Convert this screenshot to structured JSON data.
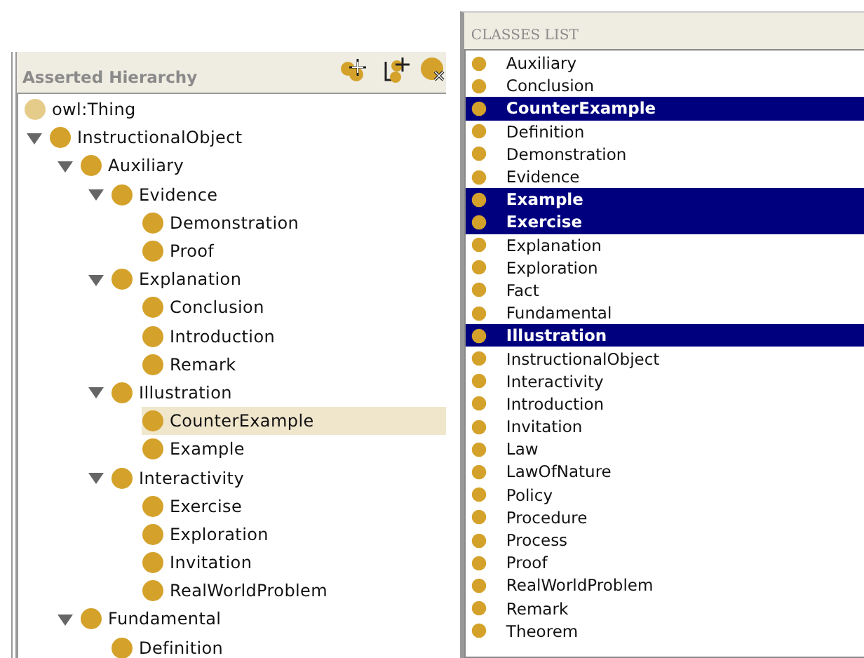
{
  "hierarchy": {
    "title": "Asserted Hierarchy",
    "tree": [
      {
        "label": "owl:Thing",
        "kind": "thing",
        "selected": false
      },
      {
        "label": "InstructionalObject",
        "kind": "class",
        "selected": false,
        "expanded": true,
        "children": [
          {
            "label": "Auxiliary",
            "kind": "class",
            "selected": false,
            "expanded": true,
            "children": [
              {
                "label": "Evidence",
                "kind": "class",
                "selected": false,
                "expanded": true,
                "children": [
                  {
                    "label": "Demonstration",
                    "kind": "class",
                    "selected": false
                  },
                  {
                    "label": "Proof",
                    "kind": "class",
                    "selected": false
                  }
                ]
              },
              {
                "label": "Explanation",
                "kind": "class",
                "selected": false,
                "expanded": true,
                "children": [
                  {
                    "label": "Conclusion",
                    "kind": "class",
                    "selected": false
                  },
                  {
                    "label": "Introduction",
                    "kind": "class",
                    "selected": false
                  },
                  {
                    "label": "Remark",
                    "kind": "class",
                    "selected": false
                  }
                ]
              },
              {
                "label": "Illustration",
                "kind": "class",
                "selected": false,
                "expanded": true,
                "children": [
                  {
                    "label": "CounterExample",
                    "kind": "class",
                    "selected": true
                  },
                  {
                    "label": "Example",
                    "kind": "class",
                    "selected": false
                  }
                ]
              },
              {
                "label": "Interactivity",
                "kind": "class",
                "selected": false,
                "expanded": true,
                "children": [
                  {
                    "label": "Exercise",
                    "kind": "class",
                    "selected": false
                  },
                  {
                    "label": "Exploration",
                    "kind": "class",
                    "selected": false
                  },
                  {
                    "label": "Invitation",
                    "kind": "class",
                    "selected": false
                  },
                  {
                    "label": "RealWorldProblem",
                    "kind": "class",
                    "selected": false
                  }
                ]
              }
            ]
          },
          {
            "label": "Fundamental",
            "kind": "class",
            "selected": false,
            "expanded": true,
            "children": [
              {
                "label": "Definition",
                "kind": "class",
                "selected": false
              }
            ]
          }
        ]
      }
    ]
  },
  "classes_list": {
    "title": "CLASSES LIST",
    "items": [
      {
        "label": "Auxiliary",
        "selected": false
      },
      {
        "label": "Conclusion",
        "selected": false
      },
      {
        "label": "CounterExample",
        "selected": true
      },
      {
        "label": "Definition",
        "selected": false
      },
      {
        "label": "Demonstration",
        "selected": false
      },
      {
        "label": "Evidence",
        "selected": false
      },
      {
        "label": "Example",
        "selected": true
      },
      {
        "label": "Exercise",
        "selected": true
      },
      {
        "label": "Explanation",
        "selected": false
      },
      {
        "label": "Exploration",
        "selected": false
      },
      {
        "label": "Fact",
        "selected": false
      },
      {
        "label": "Fundamental",
        "selected": false
      },
      {
        "label": "Illustration",
        "selected": true
      },
      {
        "label": "InstructionalObject",
        "selected": false
      },
      {
        "label": "Interactivity",
        "selected": false
      },
      {
        "label": "Introduction",
        "selected": false
      },
      {
        "label": "Invitation",
        "selected": false
      },
      {
        "label": "Law",
        "selected": false
      },
      {
        "label": "LawOfNature",
        "selected": false
      },
      {
        "label": "Policy",
        "selected": false
      },
      {
        "label": "Procedure",
        "selected": false
      },
      {
        "label": "Process",
        "selected": false
      },
      {
        "label": "Proof",
        "selected": false
      },
      {
        "label": "RealWorldProblem",
        "selected": false
      },
      {
        "label": "Remark",
        "selected": false
      },
      {
        "label": "Theorem",
        "selected": false
      }
    ]
  }
}
